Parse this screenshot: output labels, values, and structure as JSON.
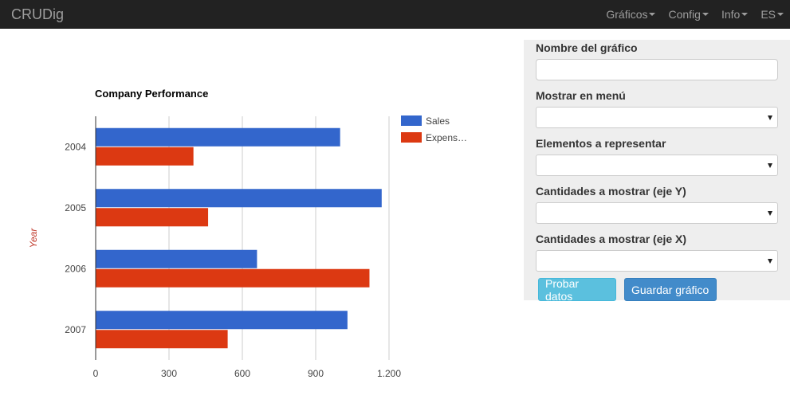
{
  "navbar": {
    "brand": "CRUDig",
    "menu": [
      {
        "label": "Gráficos",
        "name": "nav-graficos"
      },
      {
        "label": "Config",
        "name": "nav-config"
      },
      {
        "label": "Info",
        "name": "nav-info"
      },
      {
        "label": "ES",
        "name": "nav-language"
      }
    ]
  },
  "form": {
    "chart_name_label": "Nombre del gráfico",
    "chart_name_value": "",
    "show_in_menu_label": "Mostrar en menú",
    "elements_label": "Elementos a representar",
    "y_axis_label": "Cantidades a mostrar (eje Y)",
    "x_axis_label": "Cantidades a mostrar (eje X)",
    "test_button": "Probar datos",
    "save_button": "Guardar gráfico"
  },
  "colors": {
    "sales": "#3366cc",
    "expenses": "#dc3912",
    "axis_title": "#c0392b"
  },
  "chart_data": {
    "type": "bar",
    "orientation": "horizontal",
    "title": "Company Performance",
    "ylabel": "Year",
    "categories": [
      "2004",
      "2005",
      "2006",
      "2007"
    ],
    "series": [
      {
        "name": "Sales",
        "legend_text": "Sales",
        "values": [
          1000,
          1170,
          660,
          1030
        ]
      },
      {
        "name": "Expenses",
        "legend_text": "Expens…",
        "values": [
          400,
          460,
          1120,
          540
        ]
      }
    ],
    "xlim": [
      0,
      1200
    ],
    "xticks": [
      "0",
      "300",
      "600",
      "900",
      "1.200"
    ],
    "grid": true,
    "legend": "right"
  }
}
